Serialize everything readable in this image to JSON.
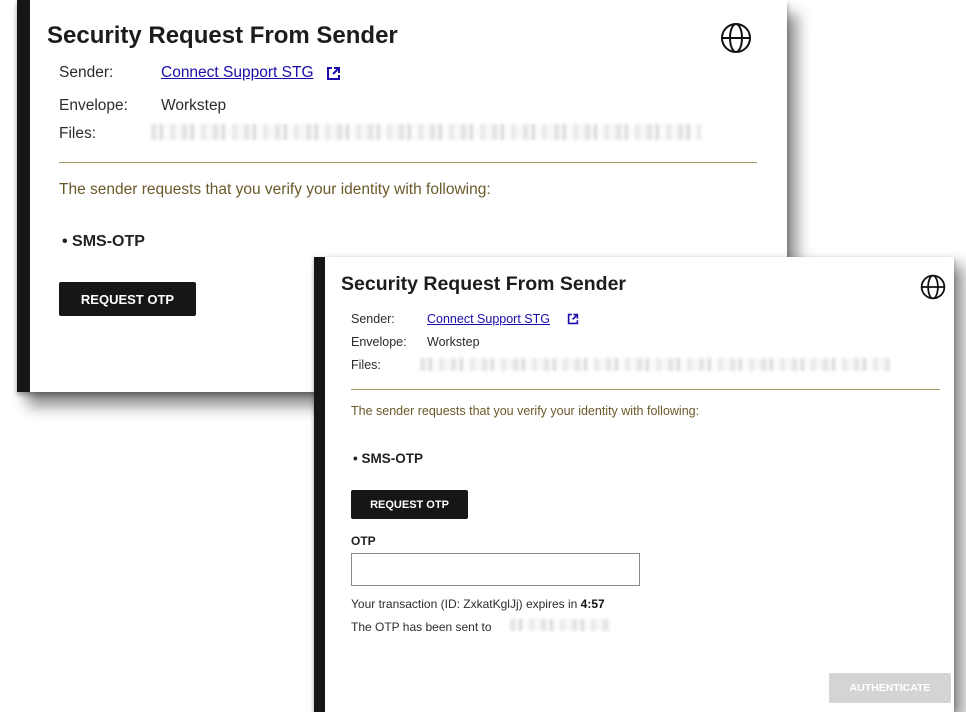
{
  "back_card": {
    "title": "Security Request From Sender",
    "sender_label": "Sender:",
    "sender_value": "Connect Support STG",
    "envelope_label": "Envelope:",
    "envelope_value": "Workstep",
    "files_label": "Files:",
    "request_text": "The sender requests that you verify your identity with following:",
    "method": "•  SMS-OTP",
    "request_otp_label": "REQUEST OTP"
  },
  "front_card": {
    "title": "Security Request From Sender",
    "sender_label": "Sender:",
    "sender_value": "Connect Support STG",
    "envelope_label": "Envelope:",
    "envelope_value": "Workstep",
    "files_label": "Files:",
    "request_text": "The sender requests that you verify your identity with following:",
    "method": "•  SMS-OTP",
    "request_otp_label": "REQUEST OTP",
    "otp_label": "OTP",
    "otp_value": "",
    "transaction_prefix": "Your transaction (ID: ZxkatKglJj) expires in ",
    "countdown": "4:57",
    "otp_sent_text": "The OTP has been sent to",
    "authenticate_label": "AUTHENTICATE"
  },
  "icons": {
    "language": "globe-icon",
    "external_link": "external-link-icon"
  },
  "colors": {
    "accent_bar": "#161616",
    "link": "#1a0dab",
    "divider": "#a99b6a",
    "request_text": "#6a5a2a",
    "disabled_button": "#d4d4d4"
  }
}
